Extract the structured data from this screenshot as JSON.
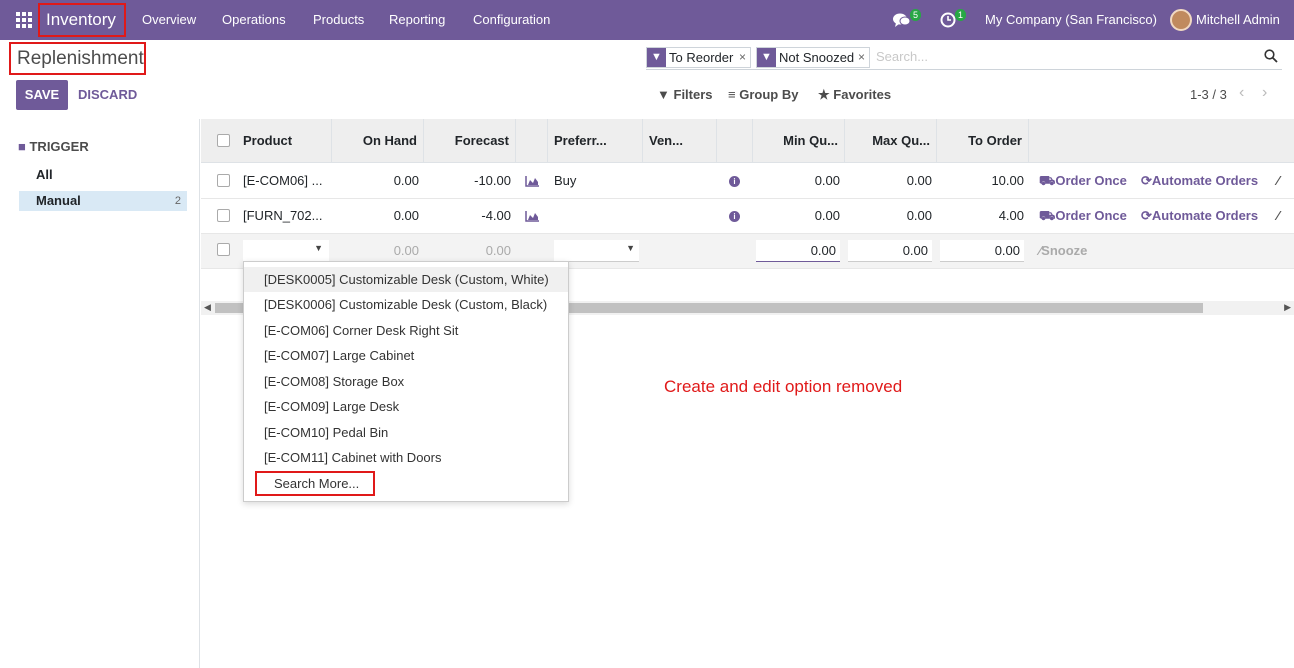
{
  "nav": {
    "app_name": "Inventory",
    "menu": [
      "Overview",
      "Operations",
      "Products",
      "Reporting",
      "Configuration"
    ],
    "chat_count": "5",
    "activity_count": "1",
    "company": "My Company (San Francisco)",
    "user": "Mitchell Admin"
  },
  "page": {
    "title": "Replenishment",
    "save_label": "SAVE",
    "discard_label": "DISCARD"
  },
  "search": {
    "facets": [
      "To Reorder",
      "Not Snoozed"
    ],
    "placeholder": "Search...",
    "filters_label": "Filters",
    "groupby_label": "Group By",
    "favorites_label": "Favorites",
    "pager": "1-3 / 3"
  },
  "sidebar": {
    "heading": "TRIGGER",
    "items": [
      {
        "label": "All",
        "count": ""
      },
      {
        "label": "Manual",
        "count": "2"
      }
    ]
  },
  "table": {
    "headers": [
      "Product",
      "On Hand",
      "Forecast",
      "Preferr...",
      "Ven...",
      "Min Qu...",
      "Max Qu...",
      "To Order"
    ],
    "rows": [
      {
        "product": "[E-COM06] ...",
        "on_hand": "0.00",
        "forecast": "-10.00",
        "route": "Buy",
        "min": "0.00",
        "max": "0.00",
        "to_order": "10.00"
      },
      {
        "product": "[FURN_702...",
        "on_hand": "0.00",
        "forecast": "-4.00",
        "route": "",
        "min": "0.00",
        "max": "0.00",
        "to_order": "4.00"
      }
    ],
    "edit_row": {
      "on_hand": "0.00",
      "forecast": "0.00",
      "min": "0.00",
      "max": "0.00",
      "to_order": "0.00",
      "snooze": "Snooze"
    },
    "order_once": "Order Once",
    "automate_orders": "Automate Orders"
  },
  "dropdown": {
    "items": [
      "[DESK0005] Customizable Desk (Custom, White)",
      "[DESK0006] Customizable Desk (Custom, Black)",
      "[E-COM06] Corner Desk Right Sit",
      "[E-COM07] Large Cabinet",
      "[E-COM08] Storage Box",
      "[E-COM09] Large Desk",
      "[E-COM10] Pedal Bin",
      "[E-COM11] Cabinet with Doors"
    ],
    "search_more": "Search More..."
  },
  "annotation": "Create and edit option removed",
  "colors": {
    "brand": "#6f5a99",
    "highlight_box": "#e01919",
    "badge": "#28a745"
  }
}
